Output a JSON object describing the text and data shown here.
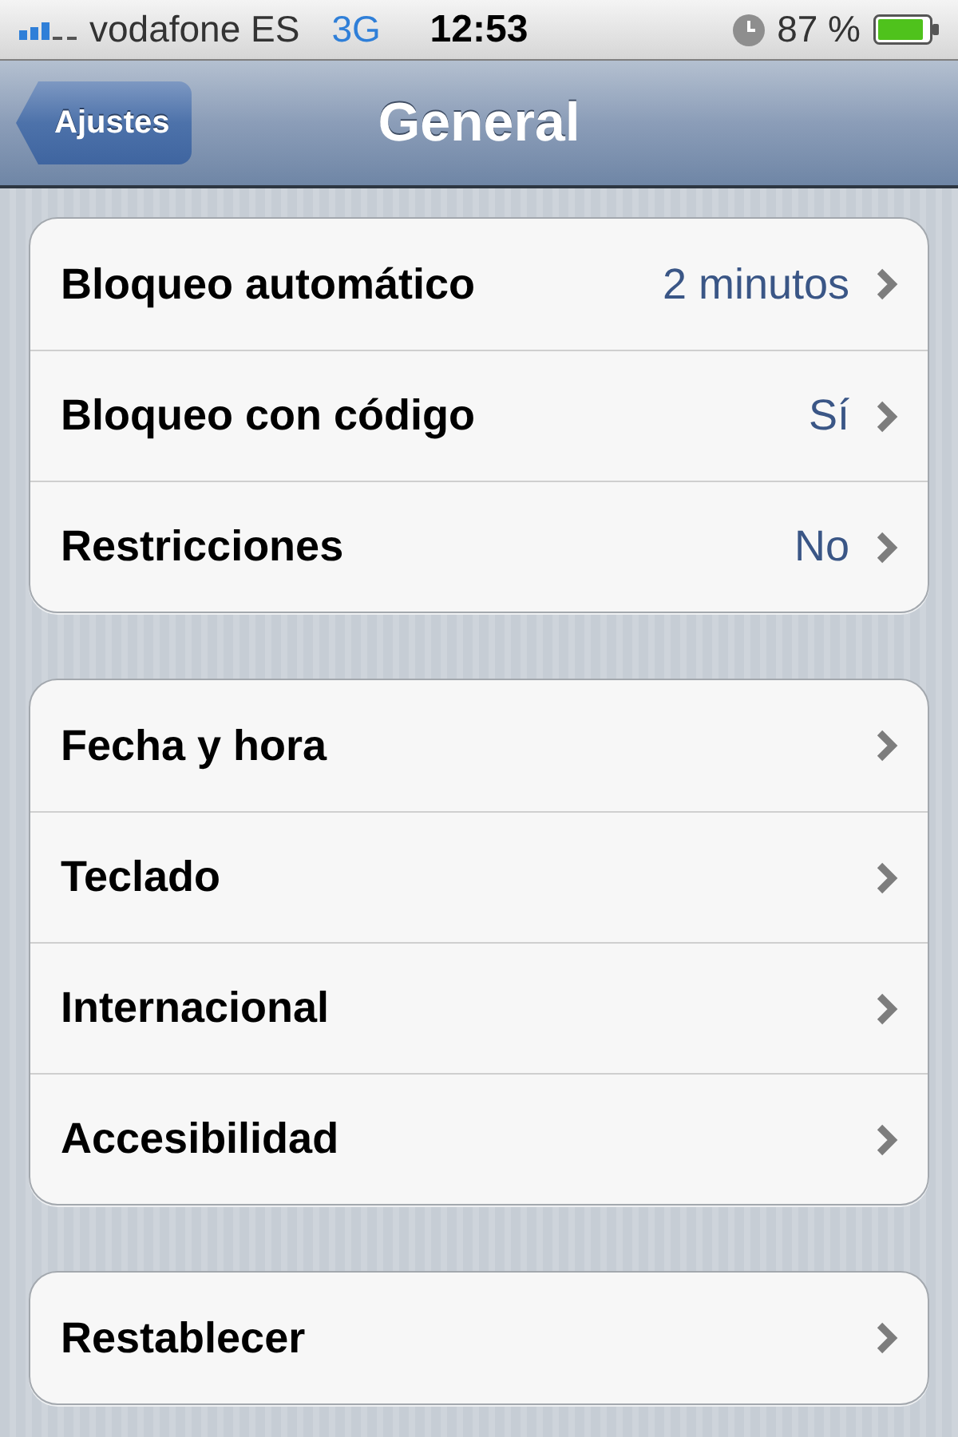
{
  "status_bar": {
    "carrier": "vodafone ES",
    "network": "3G",
    "time": "12:53",
    "battery": "87 %"
  },
  "nav_bar": {
    "back_button": "Ajustes",
    "title": "General"
  },
  "groups": [
    {
      "rows": [
        {
          "label": "Bloqueo automático",
          "value": "2 minutos"
        },
        {
          "label": "Bloqueo con código",
          "value": "Sí"
        },
        {
          "label": "Restricciones",
          "value": "No"
        }
      ]
    },
    {
      "rows": [
        {
          "label": "Fecha y hora"
        },
        {
          "label": "Teclado"
        },
        {
          "label": "Internacional"
        },
        {
          "label": "Accesibilidad"
        }
      ]
    },
    {
      "rows": [
        {
          "label": "Restablecer"
        }
      ]
    }
  ]
}
